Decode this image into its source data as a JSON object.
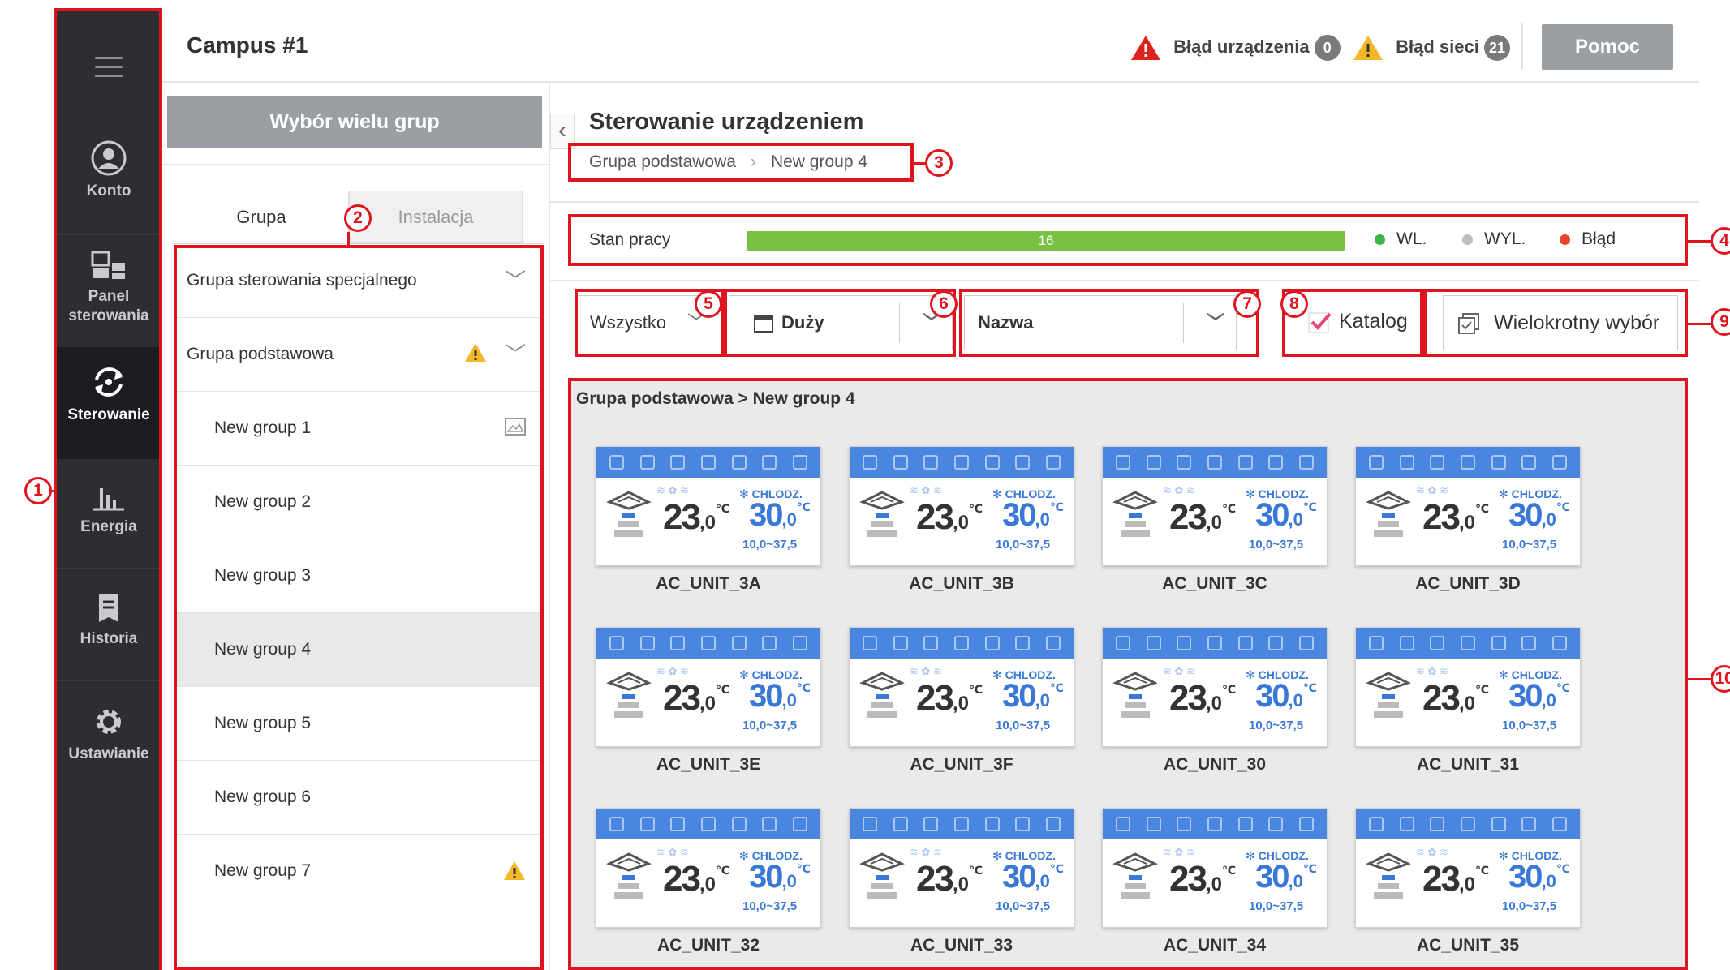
{
  "nav": {
    "items": [
      {
        "label": "Konto",
        "icon": "account-icon"
      },
      {
        "label": "Panel sterowania",
        "icon": "dashboard-icon"
      },
      {
        "label": "Sterowanie",
        "icon": "control-icon"
      },
      {
        "label": "Energia",
        "icon": "energy-chart-icon"
      },
      {
        "label": "Historia",
        "icon": "history-icon"
      },
      {
        "label": "Ustawianie",
        "icon": "gear-icon"
      }
    ]
  },
  "header": {
    "title": "Campus #1",
    "device_error_label": "Błąd urządzenia",
    "device_error_count": "0",
    "network_error_label": "Błąd sieci",
    "network_error_count": "21",
    "help_label": "Pomoc"
  },
  "groups_panel": {
    "multi_select_label": "Wybór wielu grup",
    "tabs": [
      "Grupa",
      "Instalacja"
    ],
    "rows": [
      {
        "label": "Grupa sterowania specjalnego"
      },
      {
        "label": "Grupa podstawowa"
      },
      {
        "label": "New group 1"
      },
      {
        "label": "New group 2"
      },
      {
        "label": "New group 3"
      },
      {
        "label": "New group 4"
      },
      {
        "label": "New group 5"
      },
      {
        "label": "New group 6"
      },
      {
        "label": "New group 7"
      }
    ]
  },
  "main": {
    "title": "Sterowanie urządzeniem",
    "breadcrumb": [
      "Grupa podstawowa",
      "New group 4"
    ],
    "status_label": "Stan pracy",
    "status_count": "16",
    "legend": [
      "WL.",
      "WYL.",
      "Błąd"
    ],
    "filter_all": "Wszystko",
    "view_size": "Duży",
    "sort_by": "Nazwa",
    "catalog_label": "Katalog",
    "multi_select_label": "Wielokrotny wybór",
    "grid_path": "Grupa podstawowa > New group 4",
    "units": [
      "AC_UNIT_3A",
      "AC_UNIT_3B",
      "AC_UNIT_3C",
      "AC_UNIT_3D",
      "AC_UNIT_3E",
      "AC_UNIT_3F",
      "AC_UNIT_30",
      "AC_UNIT_31",
      "AC_UNIT_32",
      "AC_UNIT_33",
      "AC_UNIT_34",
      "AC_UNIT_35"
    ],
    "card": {
      "mode": "CHLODZ.",
      "current_int": "23",
      "current_dec": ",0",
      "set_int": "30",
      "set_dec": ",0",
      "unit": "℃",
      "range": "10,0~37,5"
    }
  },
  "callouts": [
    "1",
    "2",
    "3",
    "4",
    "5",
    "6",
    "7",
    "8",
    "9",
    "10"
  ],
  "colors": {
    "nav_bg": "#2d2e32",
    "accent_blue": "#4a86e0",
    "status_green": "#7ac143",
    "annotation_red": "#e0141e"
  }
}
